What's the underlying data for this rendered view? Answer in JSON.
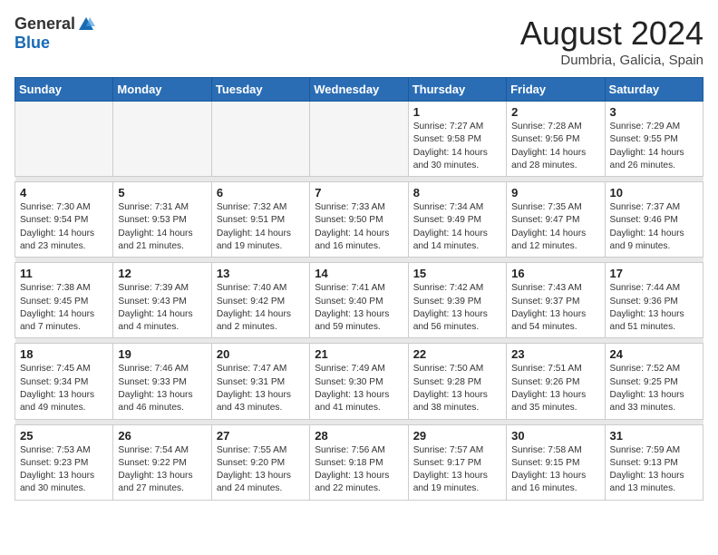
{
  "logo": {
    "general": "General",
    "blue": "Blue"
  },
  "title": {
    "month_year": "August 2024",
    "location": "Dumbria, Galicia, Spain"
  },
  "days_of_week": [
    "Sunday",
    "Monday",
    "Tuesday",
    "Wednesday",
    "Thursday",
    "Friday",
    "Saturday"
  ],
  "weeks": [
    [
      {
        "day": "",
        "info": ""
      },
      {
        "day": "",
        "info": ""
      },
      {
        "day": "",
        "info": ""
      },
      {
        "day": "",
        "info": ""
      },
      {
        "day": "1",
        "info": "Sunrise: 7:27 AM\nSunset: 9:58 PM\nDaylight: 14 hours\nand 30 minutes."
      },
      {
        "day": "2",
        "info": "Sunrise: 7:28 AM\nSunset: 9:56 PM\nDaylight: 14 hours\nand 28 minutes."
      },
      {
        "day": "3",
        "info": "Sunrise: 7:29 AM\nSunset: 9:55 PM\nDaylight: 14 hours\nand 26 minutes."
      }
    ],
    [
      {
        "day": "4",
        "info": "Sunrise: 7:30 AM\nSunset: 9:54 PM\nDaylight: 14 hours\nand 23 minutes."
      },
      {
        "day": "5",
        "info": "Sunrise: 7:31 AM\nSunset: 9:53 PM\nDaylight: 14 hours\nand 21 minutes."
      },
      {
        "day": "6",
        "info": "Sunrise: 7:32 AM\nSunset: 9:51 PM\nDaylight: 14 hours\nand 19 minutes."
      },
      {
        "day": "7",
        "info": "Sunrise: 7:33 AM\nSunset: 9:50 PM\nDaylight: 14 hours\nand 16 minutes."
      },
      {
        "day": "8",
        "info": "Sunrise: 7:34 AM\nSunset: 9:49 PM\nDaylight: 14 hours\nand 14 minutes."
      },
      {
        "day": "9",
        "info": "Sunrise: 7:35 AM\nSunset: 9:47 PM\nDaylight: 14 hours\nand 12 minutes."
      },
      {
        "day": "10",
        "info": "Sunrise: 7:37 AM\nSunset: 9:46 PM\nDaylight: 14 hours\nand 9 minutes."
      }
    ],
    [
      {
        "day": "11",
        "info": "Sunrise: 7:38 AM\nSunset: 9:45 PM\nDaylight: 14 hours\nand 7 minutes."
      },
      {
        "day": "12",
        "info": "Sunrise: 7:39 AM\nSunset: 9:43 PM\nDaylight: 14 hours\nand 4 minutes."
      },
      {
        "day": "13",
        "info": "Sunrise: 7:40 AM\nSunset: 9:42 PM\nDaylight: 14 hours\nand 2 minutes."
      },
      {
        "day": "14",
        "info": "Sunrise: 7:41 AM\nSunset: 9:40 PM\nDaylight: 13 hours\nand 59 minutes."
      },
      {
        "day": "15",
        "info": "Sunrise: 7:42 AM\nSunset: 9:39 PM\nDaylight: 13 hours\nand 56 minutes."
      },
      {
        "day": "16",
        "info": "Sunrise: 7:43 AM\nSunset: 9:37 PM\nDaylight: 13 hours\nand 54 minutes."
      },
      {
        "day": "17",
        "info": "Sunrise: 7:44 AM\nSunset: 9:36 PM\nDaylight: 13 hours\nand 51 minutes."
      }
    ],
    [
      {
        "day": "18",
        "info": "Sunrise: 7:45 AM\nSunset: 9:34 PM\nDaylight: 13 hours\nand 49 minutes."
      },
      {
        "day": "19",
        "info": "Sunrise: 7:46 AM\nSunset: 9:33 PM\nDaylight: 13 hours\nand 46 minutes."
      },
      {
        "day": "20",
        "info": "Sunrise: 7:47 AM\nSunset: 9:31 PM\nDaylight: 13 hours\nand 43 minutes."
      },
      {
        "day": "21",
        "info": "Sunrise: 7:49 AM\nSunset: 9:30 PM\nDaylight: 13 hours\nand 41 minutes."
      },
      {
        "day": "22",
        "info": "Sunrise: 7:50 AM\nSunset: 9:28 PM\nDaylight: 13 hours\nand 38 minutes."
      },
      {
        "day": "23",
        "info": "Sunrise: 7:51 AM\nSunset: 9:26 PM\nDaylight: 13 hours\nand 35 minutes."
      },
      {
        "day": "24",
        "info": "Sunrise: 7:52 AM\nSunset: 9:25 PM\nDaylight: 13 hours\nand 33 minutes."
      }
    ],
    [
      {
        "day": "25",
        "info": "Sunrise: 7:53 AM\nSunset: 9:23 PM\nDaylight: 13 hours\nand 30 minutes."
      },
      {
        "day": "26",
        "info": "Sunrise: 7:54 AM\nSunset: 9:22 PM\nDaylight: 13 hours\nand 27 minutes."
      },
      {
        "day": "27",
        "info": "Sunrise: 7:55 AM\nSunset: 9:20 PM\nDaylight: 13 hours\nand 24 minutes."
      },
      {
        "day": "28",
        "info": "Sunrise: 7:56 AM\nSunset: 9:18 PM\nDaylight: 13 hours\nand 22 minutes."
      },
      {
        "day": "29",
        "info": "Sunrise: 7:57 AM\nSunset: 9:17 PM\nDaylight: 13 hours\nand 19 minutes."
      },
      {
        "day": "30",
        "info": "Sunrise: 7:58 AM\nSunset: 9:15 PM\nDaylight: 13 hours\nand 16 minutes."
      },
      {
        "day": "31",
        "info": "Sunrise: 7:59 AM\nSunset: 9:13 PM\nDaylight: 13 hours\nand 13 minutes."
      }
    ]
  ]
}
